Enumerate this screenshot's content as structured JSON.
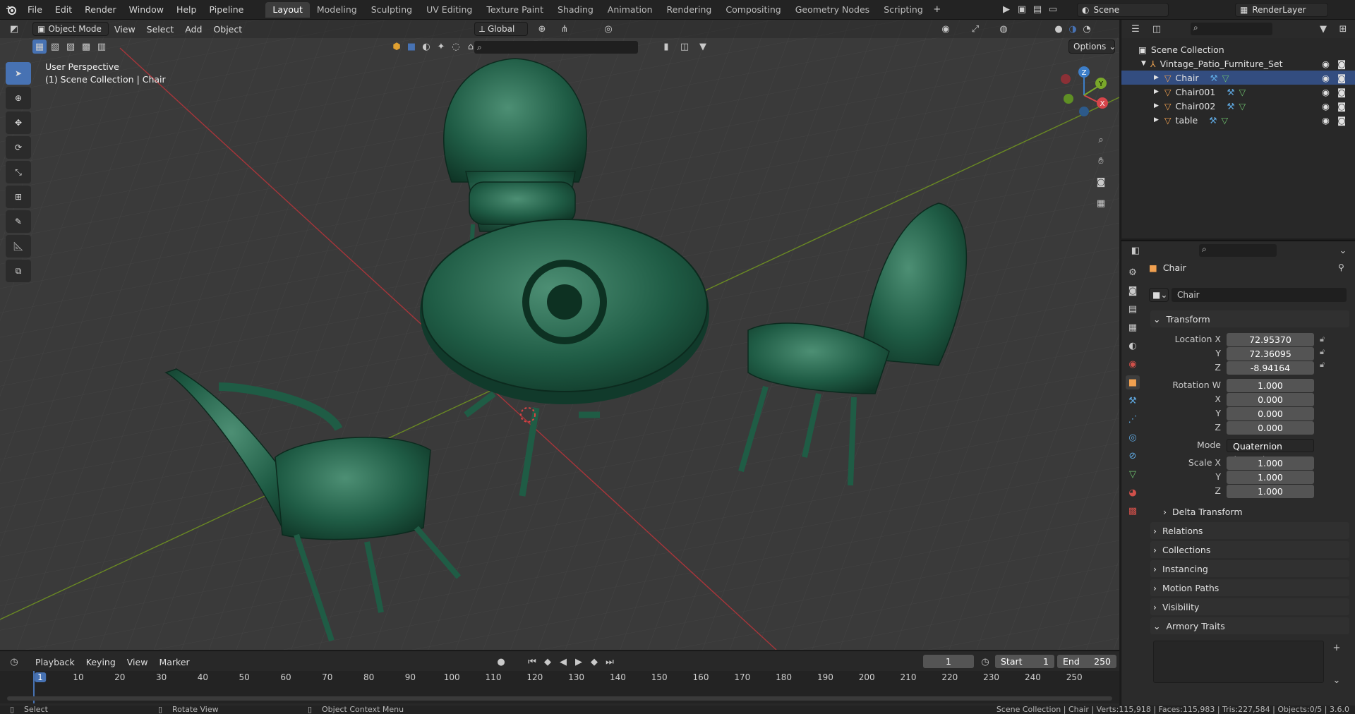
{
  "topbar": {
    "menus": [
      "File",
      "Edit",
      "Render",
      "Window",
      "Help",
      "Pipeline"
    ],
    "workspaces": [
      "Layout",
      "Modeling",
      "Sculpting",
      "UV Editing",
      "Texture Paint",
      "Shading",
      "Animation",
      "Rendering",
      "Compositing",
      "Geometry Nodes",
      "Scripting"
    ],
    "active_workspace": "Layout",
    "scene_name": "Scene",
    "view_layer": "RenderLayer"
  },
  "viewport": {
    "mode": "Object Mode",
    "menus": [
      "View",
      "Select",
      "Add",
      "Object"
    ],
    "orientation": "Global",
    "options_label": "Options",
    "overlay_line1": "User Perspective",
    "overlay_line2": "(1) Scene Collection | Chair",
    "gizmo": {
      "x": "X",
      "y": "Y",
      "z": "Z"
    }
  },
  "outliner": {
    "root": "Scene Collection",
    "collection": "Vintage_Patio_Furniture_Set",
    "items": [
      "Chair",
      "Chair001",
      "Chair002",
      "table"
    ]
  },
  "properties": {
    "object_name": "Chair",
    "datablock_name": "Chair",
    "transform_header": "Transform",
    "location_label": "Location X",
    "loc": {
      "x": "72.95370",
      "y": "72.36095",
      "z": "-8.94164"
    },
    "rotation_label": "Rotation W",
    "rot": {
      "w": "1.000",
      "x": "0.000",
      "y": "0.000",
      "z": "0.000"
    },
    "mode_label": "Mode",
    "mode_value": "Quaternion (WXYZ)",
    "scale_label": "Scale X",
    "scale": {
      "x": "1.000",
      "y": "1.000",
      "z": "1.000"
    },
    "axis_y": "Y",
    "axis_z": "Z",
    "axis_x": "X",
    "sections": [
      "Delta Transform",
      "Relations",
      "Collections",
      "Instancing",
      "Motion Paths",
      "Visibility",
      "Armory Traits"
    ]
  },
  "timeline": {
    "menus": [
      "Playback",
      "Keying",
      "View",
      "Marker"
    ],
    "current_frame": "1",
    "start_label": "Start",
    "start_value": "1",
    "end_label": "End",
    "end_value": "250",
    "ticks": [
      "1",
      "10",
      "20",
      "30",
      "40",
      "50",
      "60",
      "70",
      "80",
      "90",
      "100",
      "110",
      "120",
      "130",
      "140",
      "150",
      "160",
      "170",
      "180",
      "190",
      "200",
      "210",
      "220",
      "230",
      "240",
      "250"
    ]
  },
  "statusbar": {
    "select": "Select",
    "rotate": "Rotate View",
    "context": "Object Context Menu",
    "stats": "Scene Collection | Chair | Verts:115,918 | Faces:115,983 | Tris:227,584 | Objects:0/5 | 3.6.0"
  },
  "colors": {
    "accent": "#4772b3",
    "furniture": "#1f5c45",
    "grid_x": "#a8353a",
    "grid_y": "#6a8a23"
  }
}
